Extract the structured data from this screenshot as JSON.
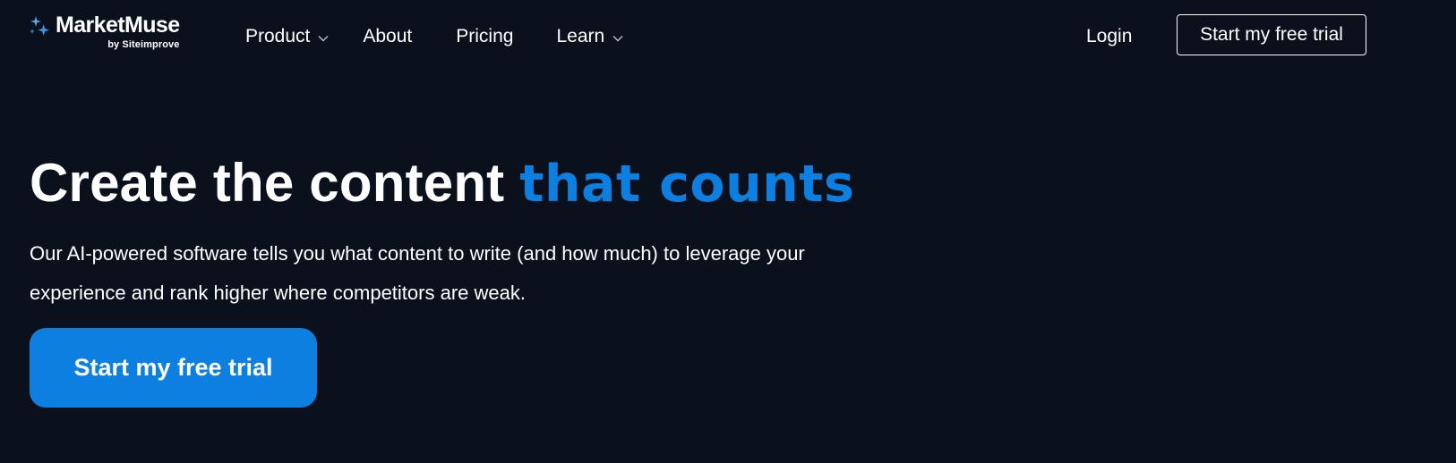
{
  "brand": {
    "name": "MarketMuse",
    "tagline": "by Siteimprove",
    "logo_icon": "sparkles-icon"
  },
  "nav": {
    "items": [
      {
        "label": "Product",
        "has_dropdown": true
      },
      {
        "label": "About",
        "has_dropdown": false
      },
      {
        "label": "Pricing",
        "has_dropdown": false
      },
      {
        "label": "Learn",
        "has_dropdown": true
      }
    ],
    "login_label": "Login",
    "trial_label": "Start my free trial"
  },
  "hero": {
    "title_plain": "Create the content ",
    "title_accent": "that counts",
    "subtitle": "Our AI-powered software tells you what content to write (and how much) to leverage your experience and rank higher where competitors are weak.",
    "cta_label": "Start my free trial"
  },
  "colors": {
    "background": "#0b111c",
    "accent": "#0c7fe0",
    "text": "#ffffff"
  }
}
